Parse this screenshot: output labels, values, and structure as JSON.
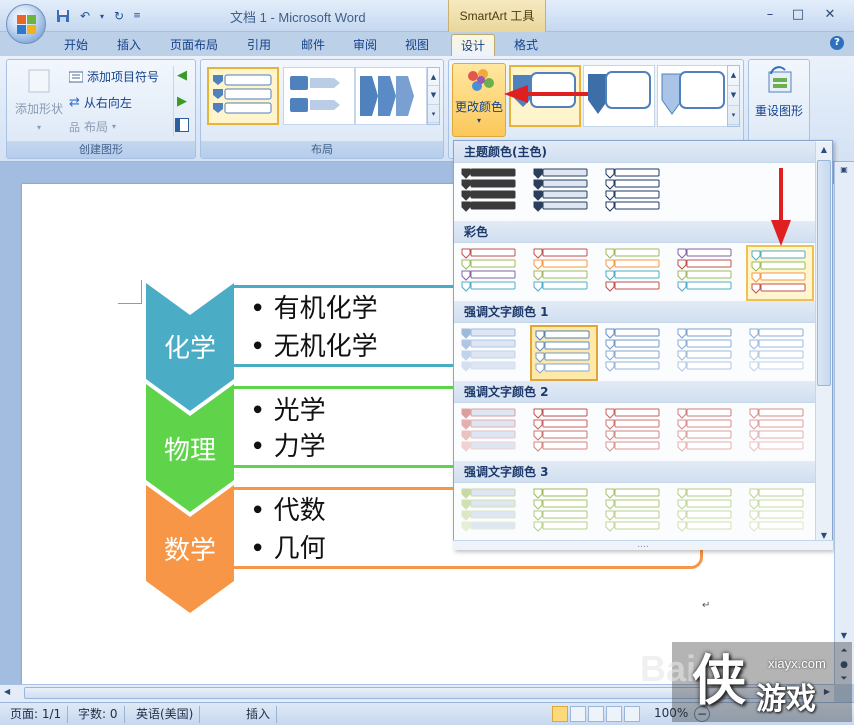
{
  "window": {
    "title": "文档 1 - Microsoft Word",
    "context_tab_title": "SmartArt 工具",
    "minimize": "–",
    "maximize": "□",
    "close": "✕"
  },
  "tabs": [
    "开始",
    "插入",
    "页面布局",
    "引用",
    "邮件",
    "审阅",
    "视图",
    "设计",
    "格式"
  ],
  "active_tab": "设计",
  "ribbon": {
    "create_group": {
      "label": "创建图形",
      "add_shape": "添加形状",
      "add_bullet": "添加项目符号",
      "right_to_left": "从右向左",
      "layout": "布局"
    },
    "layout_group": {
      "label": "布局"
    },
    "change_colors": "更改颜色",
    "reset_graphic": "重设图形"
  },
  "color_panel": {
    "sections": [
      {
        "title": "主题颜色(主色)",
        "variants": 3
      },
      {
        "title": "彩色",
        "variants": 5
      },
      {
        "title": "强调文字颜色 1",
        "variants": 5
      },
      {
        "title": "强调文字颜色 2",
        "variants": 5
      },
      {
        "title": "强调文字颜色 3",
        "variants": 5
      }
    ],
    "grip": "....",
    "colors": {
      "theme": [
        "#1f1f1f",
        "#2b3e5c",
        "#1f3864"
      ],
      "colorful": [
        [
          "#c0504d",
          "#9bbb59",
          "#8064a2",
          "#4bacc6"
        ],
        [
          "#c0504d",
          "#f79646",
          "#9bbb59",
          "#4bacc6"
        ],
        [
          "#9bbb59",
          "#f79646",
          "#4bacc6",
          "#c0504d"
        ],
        [
          "#8064a2",
          "#c0504d",
          "#9bbb59",
          "#4bacc6"
        ],
        [
          "#4bacc6",
          "#9bbb59",
          "#f79646",
          "#c0504d"
        ]
      ],
      "accent1": "#4f81bd",
      "accent2": "#c0504d",
      "accent3": "#9bbb59"
    }
  },
  "smartart": {
    "rows": [
      {
        "label": "化学",
        "color": "#4bacc6",
        "bullets": [
          "有机化学",
          "无机化学"
        ]
      },
      {
        "label": "物理",
        "color": "#5fd34a",
        "bullets": [
          "光学",
          "力学"
        ]
      },
      {
        "label": "数学",
        "color": "#f79646",
        "bullets": [
          "代数",
          "几何"
        ]
      }
    ]
  },
  "status_bar": {
    "page": "页面: 1/1",
    "words": "字数: 0",
    "language": "英语(美国)",
    "mode": "插入",
    "zoom": "100%"
  },
  "watermark": {
    "url": "xiayx.com",
    "brand": "游戏",
    "char": "侠",
    "baidu": "Bai"
  },
  "paragraph_mark": "↵"
}
